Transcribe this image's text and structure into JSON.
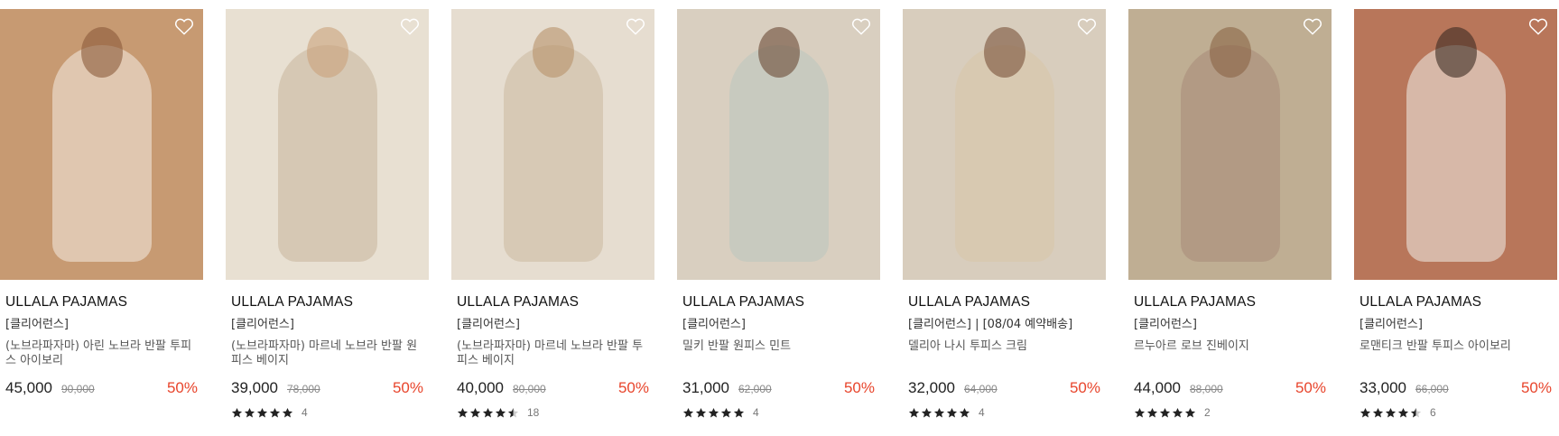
{
  "products": [
    {
      "brand": "ULLALA PAJAMAS",
      "tag": "[클리어런스]",
      "name": "(노브라파자마) 아린 노브라 반팔 투피스 아이보리",
      "price": "45,000",
      "original": "90,000",
      "discount": "50%",
      "rating": 0,
      "reviews": "",
      "colors": {
        "bg": "#c79a72",
        "fig": "#f4ede4",
        "head": "#8a5a3a"
      }
    },
    {
      "brand": "ULLALA PAJAMAS",
      "tag": "[클리어런스]",
      "name": "(노브라파자마) 마르네 노브라 반팔 원피스 베이지",
      "price": "39,000",
      "original": "78,000",
      "discount": "50%",
      "rating": 5,
      "reviews": "4",
      "colors": {
        "bg": "#e8e0d2",
        "fig": "#c7b49a",
        "head": "#c9a27c"
      }
    },
    {
      "brand": "ULLALA PAJAMAS",
      "tag": "[클리어런스]",
      "name": "(노브라파자마) 마르네 노브라 반팔 투피스 베이지",
      "price": "40,000",
      "original": "80,000",
      "discount": "50%",
      "rating": 4.5,
      "reviews": "18",
      "colors": {
        "bg": "#e6ddd0",
        "fig": "#cbb89e",
        "head": "#b8936a"
      }
    },
    {
      "brand": "ULLALA PAJAMAS",
      "tag": "[클리어런스]",
      "name": "밀키 반팔 원피스 민트",
      "price": "31,000",
      "original": "62,000",
      "discount": "50%",
      "rating": 5,
      "reviews": "4",
      "colors": {
        "bg": "#d9cfc0",
        "fig": "#b9c7bd",
        "head": "#6b4a35"
      }
    },
    {
      "brand": "ULLALA PAJAMAS",
      "tag": "[클리어런스] | [08/04 예약배송]",
      "name": "델리아 나시 투피스 크림",
      "price": "32,000",
      "original": "64,000",
      "discount": "50%",
      "rating": 5,
      "reviews": "4",
      "colors": {
        "bg": "#d8cdbd",
        "fig": "#d9c7a8",
        "head": "#7a5238"
      }
    },
    {
      "brand": "ULLALA PAJAMAS",
      "tag": "[클리어런스]",
      "name": "르누아르 로브 진베이지",
      "price": "44,000",
      "original": "88,000",
      "discount": "50%",
      "rating": 5,
      "reviews": "2",
      "colors": {
        "bg": "#bfae93",
        "fig": "#a88a78",
        "head": "#8a6444"
      }
    },
    {
      "brand": "ULLALA PAJAMAS",
      "tag": "[클리어런스]",
      "name": "로맨티크 반팔 투피스 아이보리",
      "price": "33,000",
      "original": "66,000",
      "discount": "50%",
      "rating": 4.5,
      "reviews": "6",
      "colors": {
        "bg": "#b8765a",
        "fig": "#f1eeea",
        "head": "#3a2a22"
      }
    }
  ],
  "icons": {
    "wishlist": "heart-outline-icon",
    "star": "star-icon"
  },
  "accent": "#e8452c"
}
